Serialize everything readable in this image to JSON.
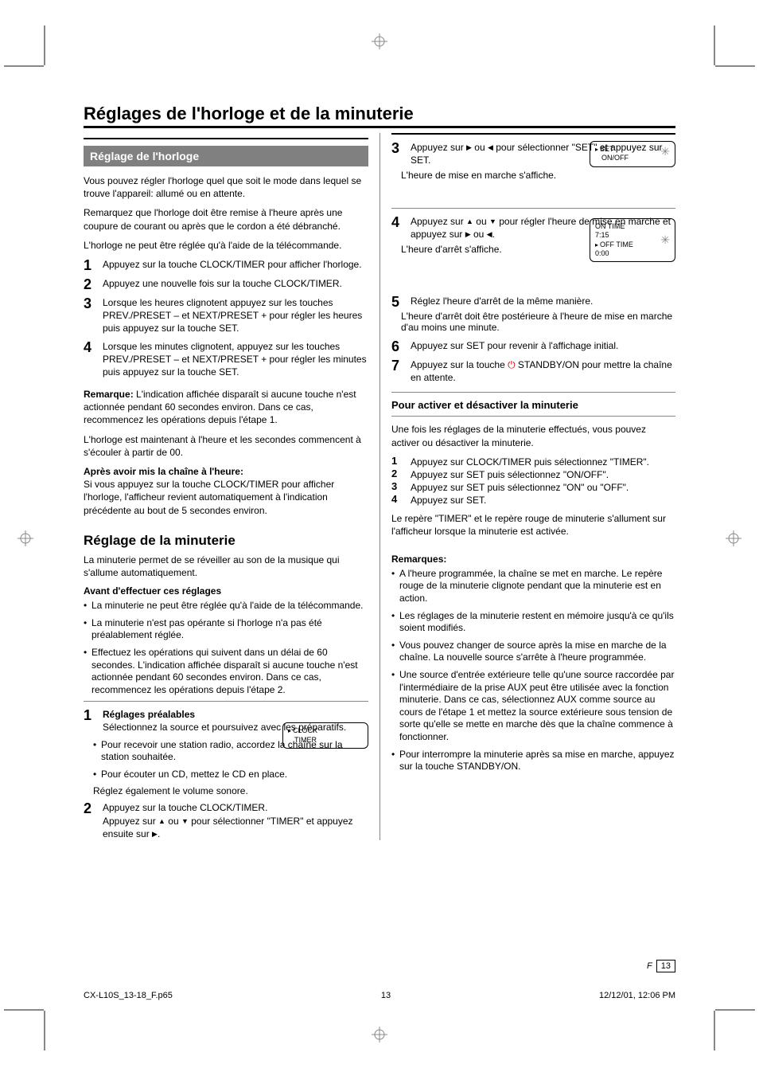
{
  "page": {
    "section_title": "Réglages de l'horloge et de la minuterie",
    "page_number_label": "F",
    "page_number": "13",
    "footer_filename": "CX-L10S_13-18_F.p65",
    "footer_page": "13",
    "footer_date": "12/12/01, 12:06 PM",
    "footer_printnum": "13"
  },
  "left": {
    "clock_heading": "Réglage de l'horloge",
    "clock_intro": "Vous pouvez régler l'horloge quel que soit le mode dans lequel se trouve l'appareil: allumé ou en attente.",
    "clock_p1": "Remarquez que l'horloge doit être remise à l'heure après une coupure de courant ou après que le cordon a été débranché.",
    "clock_p2": "L'horloge ne peut être réglée qu'à l'aide de la télécommande.",
    "clock_steps": [
      "Appuyez sur la touche CLOCK/TIMER pour afficher l'horloge.",
      "Appuyez une nouvelle fois sur la touche CLOCK/TIMER.",
      "Lorsque les heures clignotent appuyez sur les touches PREV./PRESET – et NEXT/PRESET + pour régler les heures puis appuyez sur la touche SET.",
      "Lorsque les minutes clignotent, appuyez sur les touches PREV./PRESET – et NEXT/PRESET + pour régler les minutes puis appuyez sur la touche SET."
    ],
    "clock_note_label": "Remarque:",
    "clock_note": "L'indication affichée disparaît si aucune touche n'est actionnée pendant 60 secondes environ. Dans ce cas, recommencez les opérations depuis l'étape 1.",
    "clock_post": "L'horloge est maintenant à l'heure et les secondes commencent à s'écouler à partir de 00.",
    "clock_after_heading": "Après avoir mis la chaîne à l'heure:",
    "clock_after": "Si vous appuyez sur la touche CLOCK/TIMER pour afficher l'horloge, l'afficheur revient automatiquement à l'indication précédente au bout de 5 secondes environ.",
    "timer_title": "Réglage de la minuterie",
    "timer_intro": "La minuterie permet de se réveiller au son de la musique qui s'allume automatiquement.",
    "timer_sub": "Avant d'effectuer ces réglages",
    "timer_bullets": [
      "La minuterie ne peut être réglée qu'à l'aide de la télécommande.",
      "La minuterie n'est pas opérante si l'horloge n'a pas été préalablement réglée.",
      "Effectuez les opérations qui suivent dans un délai de 60 secondes. L'indication affichée disparaît si aucune touche n'est actionnée pendant 60 secondes environ. Dans ce cas, recommencez les opérations depuis l'étape 2."
    ],
    "timer_step1_title": "Réglages préalables",
    "timer_step1_body": "Sélectionnez la source et poursuivez avec les préparatifs.",
    "timer_step1_sub": [
      "Pour recevoir une station radio, accordez la chaîne sur la station souhaitée.",
      "Pour écouter un CD, mettez le CD en place."
    ],
    "timer_step1_note": "Réglez également le volume sonore.",
    "timer_step2": {
      "line1": "Appuyez sur la touche CLOCK/TIMER.",
      "line2_prefix": "Appuyez sur ",
      "line2_or": " ou ",
      "line2_mid": " pour sélectionner \"TIMER\" et appuyez ensuite sur ",
      "line2_end": "."
    },
    "screen1": {
      "line1": "CLOCK",
      "line2": "TIMER"
    }
  },
  "right": {
    "step3": {
      "prefix": "Appuyez sur ",
      "or": " ou ",
      "suffix": " pour sélectionner \"SET\" et appuyez sur SET.",
      "note": "L'heure de mise en marche s'affiche."
    },
    "screen3": {
      "line1": "SET",
      "line2": "ON/OFF"
    },
    "step4": {
      "line1_prefix": "Appuyez sur ",
      "line1_or": " ou ",
      "line1_suffix": " pour régler l'heure de mise en marche et appuyez sur ",
      "line1_or2": " ou ",
      "line1_end": ".",
      "note": "L'heure d'arrêt s'affiche."
    },
    "screen4": {
      "line1": "ON TIME",
      "line2": "   7:15",
      "line3": "OFF TIME",
      "line4": "   0:00"
    },
    "step5": "Réglez l'heure d'arrêt de la même manière.",
    "step5_note": "L'heure d'arrêt doit être postérieure à l'heure de mise en marche d'au moins une minute.",
    "step6": "Appuyez sur SET pour revenir à l'affichage initial.",
    "step7_prefix": "Appuyez sur la touche ",
    "step7_btn": "STANDBY/ON",
    "step7_suffix": " pour mettre la chaîne en attente.",
    "activate_heading": "Pour activer et désactiver la minuterie",
    "activate_p1": "Une fois les réglages de la minuterie effectués, vous pouvez activer ou désactiver la minuterie.",
    "activate_steps": [
      "Appuyez sur CLOCK/TIMER puis sélectionnez \"TIMER\".",
      "Appuyez sur SET puis sélectionnez \"ON/OFF\".",
      "Appuyez sur SET puis sélectionnez \"ON\" ou \"OFF\".",
      "Appuyez sur SET."
    ],
    "activate_note": "Le repère \"TIMER\" et le repère rouge de minuterie s'allument sur l'afficheur lorsque la minuterie est activée.",
    "notes_label": "Remarques:",
    "notes": [
      "A l'heure programmée, la chaîne se met en marche. Le repère rouge de la minuterie clignote pendant que la minuterie est en action.",
      "Les réglages de la minuterie restent en mémoire jusqu'à ce qu'ils soient modifiés.",
      "Vous pouvez changer de source après la mise en marche de la chaîne. La nouvelle source s'arrête à l'heure programmée.",
      "Une source d'entrée extérieure telle qu'une source raccordée par l'intermédiaire de la prise AUX peut être utilisée avec la fonction minuterie. Dans ce cas, sélectionnez AUX comme source au cours de l'étape 1 et mettez la source extérieure sous tension de sorte qu'elle se mette en marche dès que la chaîne commence à fonctionner.",
      "Pour interrompre la minuterie après sa mise en marche, appuyez sur la touche STANDBY/ON."
    ]
  }
}
